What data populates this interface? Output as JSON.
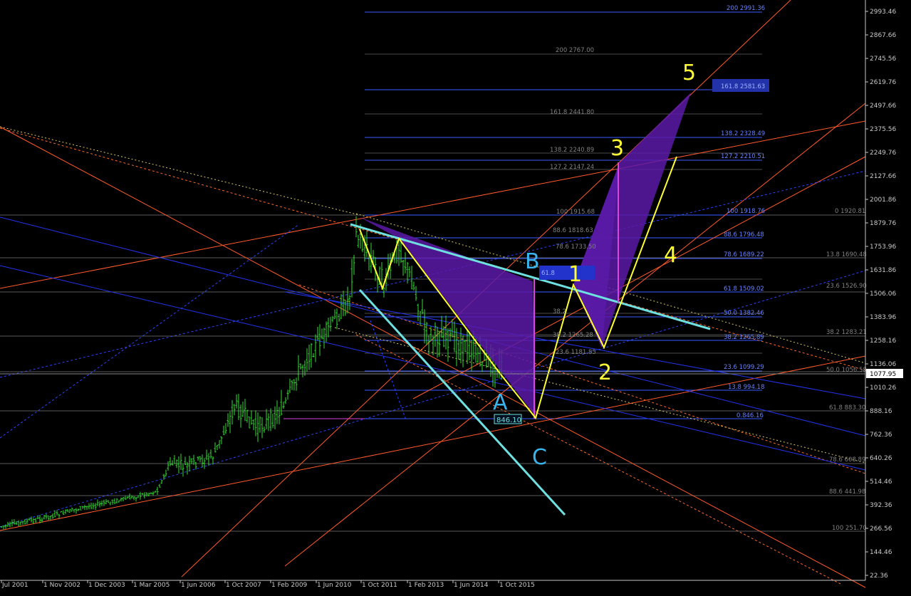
{
  "chart_data": {
    "type": "candlestick",
    "title": "",
    "colors": {
      "background": "#000000",
      "candles": "#33dd33",
      "wave_lines": "#ffff33",
      "pattern_fill": "#5a1aa8",
      "trend_cyan": "#6fe0e0",
      "fib_blue": "#3a5bff",
      "fib_gray": "#606060",
      "orange": "#ff5a2a",
      "magenta": "#dd44dd",
      "abc_labels": "#3ab4ec"
    },
    "price_ticks": [
      "2993.46",
      "2867.66",
      "2745.56",
      "2619.76",
      "2497.66",
      "2375.56",
      "2249.76",
      "2127.66",
      "2001.86",
      "1879.76",
      "1753.96",
      "1631.86",
      "1506.06",
      "1383.96",
      "1258.16",
      "1136.06",
      "1010.26",
      "888.16",
      "762.36",
      "640.26",
      "514.46",
      "392.36",
      "266.56",
      "144.46",
      "22.36"
    ],
    "current_price": "1077.95",
    "date_ticks": [
      "Jul 2001",
      "1 Nov 2002",
      "1 Dec 2003",
      "1 Mar 2005",
      "1 Jun 2006",
      "1 Oct 2007",
      "1 Feb 2009",
      "1 Jun 2010",
      "1 Oct 2011",
      "1 Feb 2013",
      "1 Jun 2014",
      "1 Oct 2015"
    ],
    "fib_labels": [
      "200 2991.36",
      "200 2767.00",
      "161.8 2581.63",
      "161.8 2441.80",
      "138.2 2328.49",
      "138.2 2240.89",
      "127.2 2210.51",
      "127.2 2147.24",
      "100 1915.68",
      "100 1918.76",
      "0 1920.81",
      "88.6 1818.63",
      "88.6 1796.48",
      "78.6 1733.50",
      "78.6 1689.22",
      "13.8 1690.48",
      "61.8",
      "61.8 1509.02",
      "23.6 1526.90",
      "38.2",
      "50.0 1382.46",
      "38.2 1283.21",
      "38.2 1265.28",
      "38.2 1265.89",
      "23.6 1181.85",
      "23.6 1099.29",
      "50.0 1056.58",
      "13.8 994.18",
      "61.8 883.30",
      "0.846.16",
      "78.6 608.89",
      "88.6 441.98",
      "100 251.70"
    ],
    "point_a_label": "846.10",
    "wave_labels": [
      "1",
      "2",
      "3",
      "4",
      "5"
    ],
    "abc_labels": [
      "A",
      "B",
      "C"
    ]
  }
}
